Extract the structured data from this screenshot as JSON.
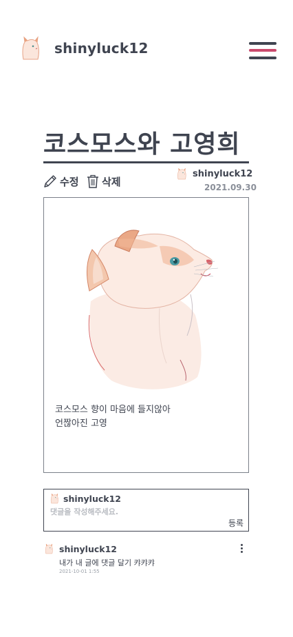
{
  "header": {
    "username": "shinyluck12",
    "avatar_icon": "cat-avatar-icon",
    "menu_icon": "hamburger-menu-icon",
    "menu_colors": [
      "#3f4450",
      "#c94a6d",
      "#3f4450"
    ]
  },
  "post": {
    "title": "코스모스와 고영희",
    "edit_label": "수정",
    "delete_label": "삭제",
    "author": "shinyluck12",
    "date": "2021.09.30",
    "body": "코스모스 향이 마음에 들지않아\n언짢아진 고영",
    "image_icon": "cat-illustration"
  },
  "comment_form": {
    "username": "shinyluck12",
    "placeholder": "댓글을 작성해주세요.",
    "submit_label": "등록"
  },
  "comments": [
    {
      "username": "shinyluck12",
      "text": "내가 내 글에 댓글 달기 캬캬캬",
      "date": "2021-10-01 1:55",
      "more_icon": "more-vertical-icon"
    }
  ],
  "colors": {
    "text": "#3f4450",
    "accent": "#c94a6d",
    "muted": "#8a8f99"
  }
}
